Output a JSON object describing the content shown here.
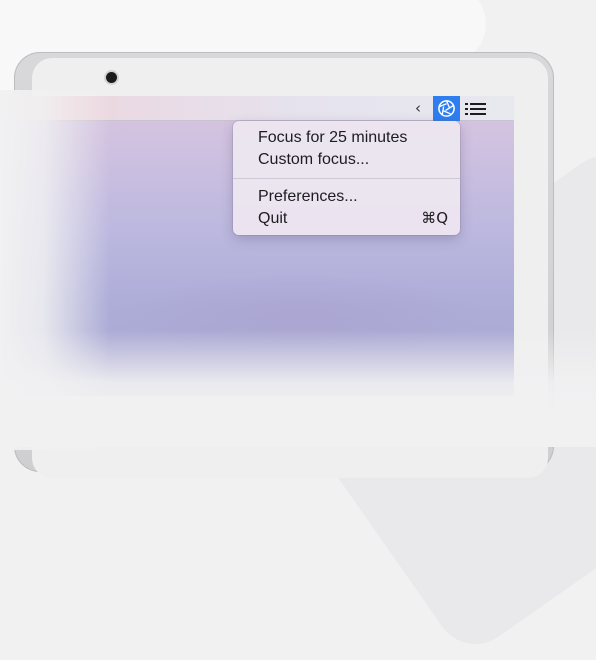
{
  "menubar": {
    "collapse_icon": "chevron-left-icon",
    "app_icon": "aperture-icon",
    "app_icon_bg": "#2f7ef0",
    "list_icon": "list-icon"
  },
  "menu": {
    "items": [
      {
        "label": "Focus for 25 minutes",
        "shortcut": ""
      },
      {
        "label": "Custom focus...",
        "shortcut": ""
      },
      {
        "label": "Preferences...",
        "shortcut": ""
      },
      {
        "label": "Quit",
        "shortcut": "⌘Q"
      }
    ]
  },
  "colors": {
    "menubar_highlight": "#2f7ef0"
  }
}
